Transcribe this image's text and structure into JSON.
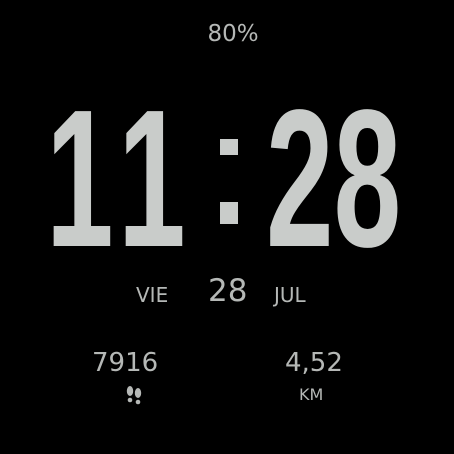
{
  "status": {
    "battery": "80%"
  },
  "time": {
    "hours": "11",
    "minutes": "28"
  },
  "date": {
    "weekday": "VIE",
    "day": "28",
    "month": "JUL"
  },
  "stats": {
    "steps": "7916",
    "steps_icon": "footsteps-icon",
    "distance": "4,52",
    "distance_unit": "KM"
  },
  "colors": {
    "background": "#000000",
    "foreground": "#c9ccca"
  }
}
